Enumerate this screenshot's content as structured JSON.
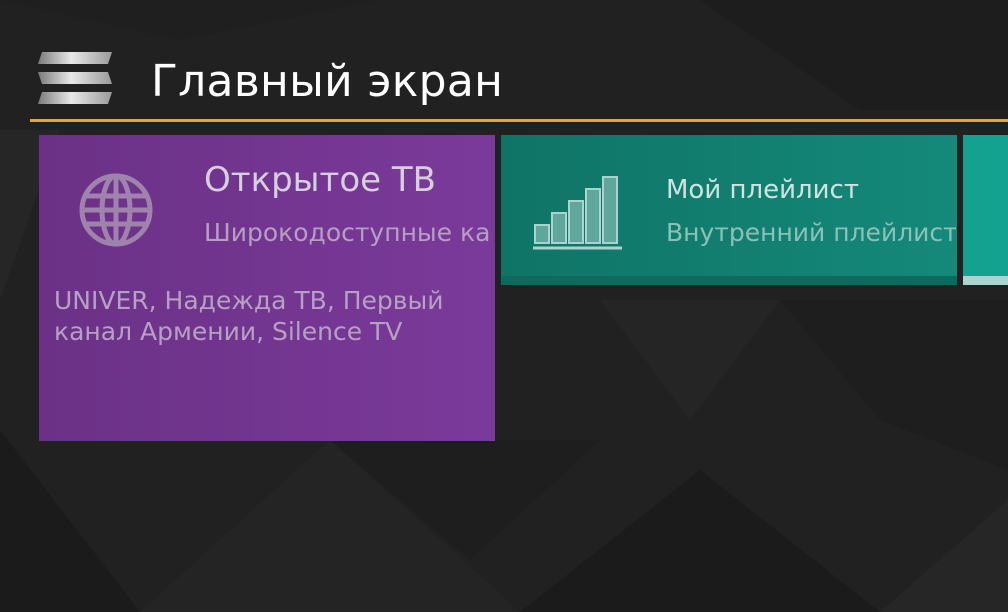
{
  "header": {
    "title": "Главный экран",
    "accent_color": "#f0a030"
  },
  "tiles": [
    {
      "title": "Открытое ТВ",
      "subtitle": "Широкодоступные каналы",
      "description": "UNIVER, Надежда ТВ, Первый канал Армении, Silence TV",
      "icon": "globe-icon",
      "color": "#7a3a9a"
    },
    {
      "title": "Мой плейлист",
      "subtitle": "Внутренний плейлист",
      "icon": "bar-chart-icon",
      "color": "#14897a"
    }
  ]
}
